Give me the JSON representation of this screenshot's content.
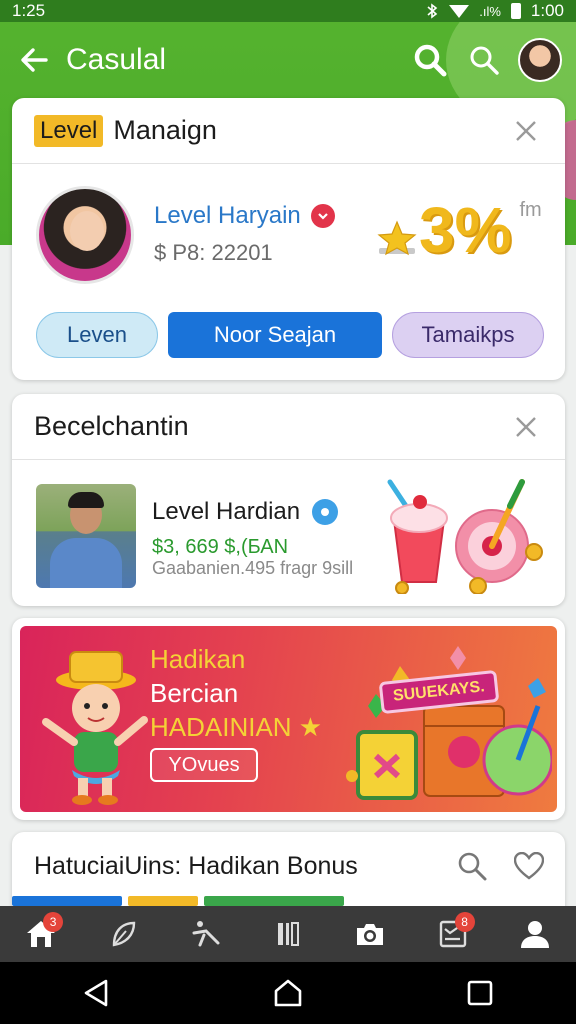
{
  "status_bar": {
    "time": "1:25",
    "right_time": "1:00",
    "signal_text": ".ıl%"
  },
  "app_bar": {
    "title": "Casulal"
  },
  "card_level": {
    "badge": "Level",
    "title": "Manaign",
    "user_name": "Level Haryain",
    "user_sub": "$ P8: 22201",
    "percent": "3%",
    "percent_unit": "fm",
    "pills": [
      "Leven",
      "Noor Seajan",
      "Tamaikps"
    ]
  },
  "card_second": {
    "title": "Becelchantin",
    "user_name": "Level Hardian",
    "amount": "$3, 669 $,(БАN",
    "meta": "Gaabanien.495  fragr 9sill"
  },
  "banner": {
    "line1": "Hadikan",
    "line2": "Bercian",
    "line3": "HADAINIAN ★",
    "button": "YOvues",
    "sign": "SUUEKAYS."
  },
  "card_fourth": {
    "title": "HatuciaiUins: Hadikan Bonus"
  },
  "bottom_nav": {
    "home_badge": "3",
    "list_badge": "8"
  },
  "colors": {
    "app_green": "#4aab29",
    "primary_blue": "#1a73d9",
    "accent_gold": "#f0b81c",
    "banner_red": "#d9245a"
  }
}
